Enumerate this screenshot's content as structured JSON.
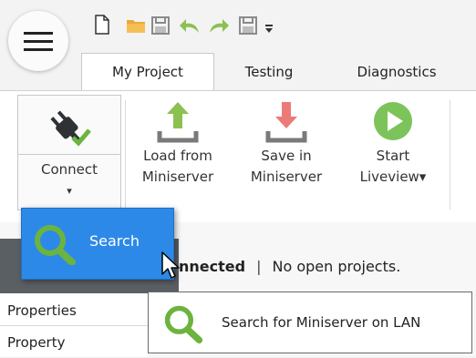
{
  "tabs": [
    {
      "label": "My Project",
      "active": true
    },
    {
      "label": "Testing",
      "active": false
    },
    {
      "label": "Diagnostics",
      "active": false
    }
  ],
  "ribbon": {
    "connect": {
      "label": "Connect",
      "arrow": "▾"
    },
    "load": {
      "line1": "Load from",
      "line2": "Miniserver"
    },
    "save": {
      "line1": "Save in",
      "line2": "Miniserver"
    },
    "start": {
      "line1": "Start",
      "line2": "Liveview▾"
    }
  },
  "search_popup": {
    "label": "Search"
  },
  "status": {
    "bold": "nnected",
    "separator": "|",
    "text": "No open projects."
  },
  "side_list": {
    "row1": "Properties",
    "row2": "Property"
  },
  "tooltip": {
    "label": "Search for Miniserver on LAN"
  },
  "colors": {
    "accent": "#2d89e8",
    "upload_green": "#8cc152",
    "download_red": "#ec7a78",
    "play_green": "#7cc35a",
    "magnifier_green": "#6cb33f"
  },
  "icons": [
    "menu-icon",
    "new-file-icon",
    "open-folder-icon",
    "save-icon",
    "undo-icon",
    "redo-icon",
    "save-as-icon",
    "dropdown-icon",
    "plug-icon",
    "upload-icon",
    "download-icon",
    "play-icon",
    "magnifier-icon",
    "cursor-icon"
  ]
}
